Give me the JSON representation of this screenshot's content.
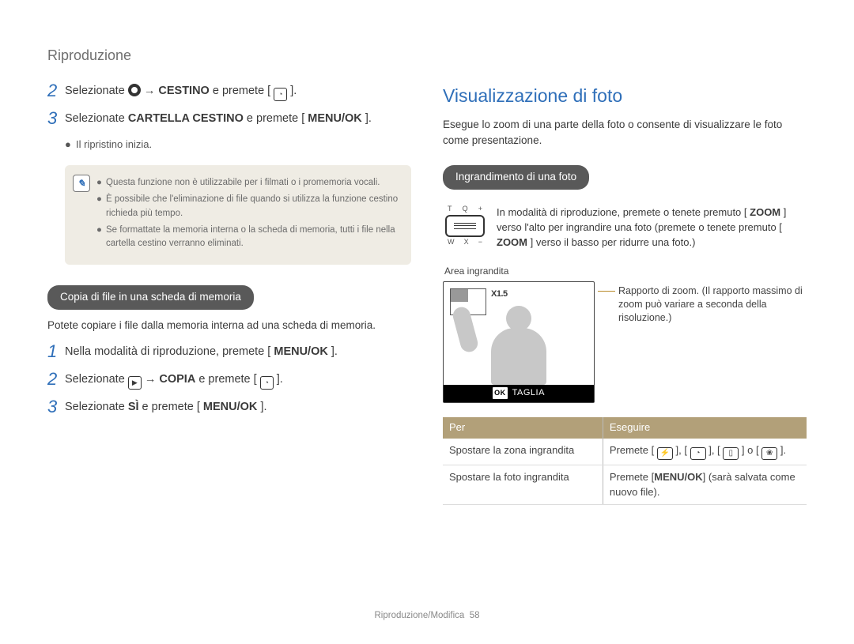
{
  "header": {
    "section": "Riproduzione"
  },
  "left": {
    "step2": {
      "num": "2",
      "pre": "Selezionate ",
      "arrow": " → ",
      "bold1": "CESTINO",
      "mid": " e premete [",
      "post": "]."
    },
    "step3": {
      "num": "3",
      "pre": "Selezionate ",
      "bold1": "CARTELLA CESTINO",
      "mid": " e premete [",
      "bold2": "MENU/OK",
      "post": "]."
    },
    "step3_bullet": "Il ripristino inizia.",
    "notes": [
      "Questa funzione non è utilizzabile per i filmati o i promemoria vocali.",
      "È possibile che l'eliminazione di file quando si utilizza la funzione cestino richieda più tempo.",
      "Se formattate la memoria interna o la scheda di memoria, tutti i file nella cartella cestino verranno eliminati."
    ],
    "pill": "Copia di file in una scheda di memoria",
    "pill_desc": "Potete copiare i file dalla memoria interna ad una scheda di memoria.",
    "copy_step1": {
      "num": "1",
      "pre": "Nella modalità di riproduzione, premete [",
      "bold": "MENU/OK",
      "post": "]."
    },
    "copy_step2": {
      "num": "2",
      "pre": "Selezionate ",
      "arrow": " → ",
      "bold": "COPIA",
      "mid": " e premete [",
      "post": "]."
    },
    "copy_step3": {
      "num": "3",
      "pre": "Selezionate ",
      "bold1": "SÌ",
      "mid": " e premete [",
      "bold2": "MENU/OK",
      "post": "]."
    }
  },
  "right": {
    "title": "Visualizzazione di foto",
    "desc": "Esegue lo zoom di una parte della foto o consente di visualizzare le foto come presentazione.",
    "pill": "Ingrandimento di una foto",
    "zoom_labels": {
      "t": "T",
      "q": "Q",
      "plus": "+",
      "w": "W",
      "x": "X",
      "minus": "−"
    },
    "zoom_text": {
      "pre": "In modalità di riproduzione, premete o tenete premuto [",
      "bold1": "ZOOM",
      "mid1": "] verso l'alto per ingrandire una foto (premete o tenete premuto [",
      "bold2": "ZOOM",
      "mid2": "] verso il basso per ridurre una foto.)"
    },
    "area_label": "Area ingrandita",
    "zoom_ratio": "X1.5",
    "taglia": "TAGLIA",
    "ok": "OK",
    "ratio_note": "Rapporto di zoom. (Il rapporto massimo di zoom può variare a seconda della risoluzione.)",
    "table": {
      "h1": "Per",
      "h2": "Eseguire",
      "r1c1": "Spostare la zona ingrandita",
      "r1c2_pre": "Premete [",
      "r1c2_sep": "], [",
      "r1c2_or": "] o [",
      "r1c2_post": "].",
      "r2c1": "Spostare la foto ingrandita",
      "r2c2_pre": "Premete ",
      "r2c2_bold": "MENU/OK",
      "r2c2_post": " (sarà salvata come nuovo file)."
    }
  },
  "footer": {
    "label": "Riproduzione/Modifica",
    "page": "58"
  }
}
